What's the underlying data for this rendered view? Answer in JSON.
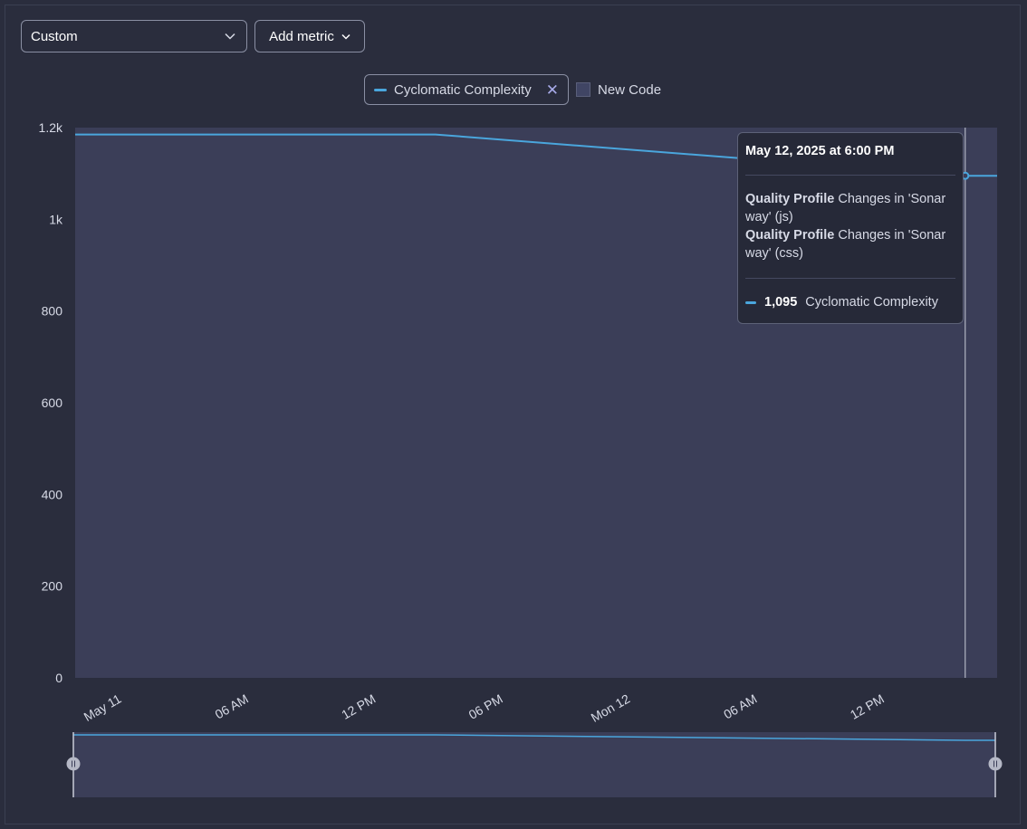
{
  "toolbar": {
    "graph_select": {
      "value": "Custom",
      "icon": "chevron-down-icon"
    },
    "add_metric_label": "Add metric"
  },
  "legend": {
    "series_label": "Cyclomatic Complexity",
    "series_color": "#4aa6dd",
    "remove_icon": "close-icon",
    "new_code_label": "New Code"
  },
  "tooltip": {
    "date": "May 12, 2025 at 6:00 PM",
    "events": [
      {
        "category": "Quality Profile",
        "text": "Changes in 'Sonar way' (js)"
      },
      {
        "category": "Quality Profile",
        "text": "Changes in 'Sonar way' (css)"
      }
    ],
    "value": "1,095",
    "series": "Cyclomatic Complexity"
  },
  "chart_data": {
    "type": "line",
    "ylim": [
      0,
      1200
    ],
    "yticks": [
      "0",
      "200",
      "400",
      "600",
      "800",
      "1k",
      "1.2k"
    ],
    "xticks": [
      "May 11",
      "06 AM",
      "12 PM",
      "06 PM",
      "Mon 12",
      "06 AM",
      "12 PM"
    ],
    "series": [
      {
        "name": "Cyclomatic Complexity",
        "color": "#4aa6dd",
        "points": [
          {
            "t": "2025-05-11 00:00",
            "y": 1185
          },
          {
            "t": "2025-05-11 17:00",
            "y": 1185
          },
          {
            "t": "2025-05-12 18:00",
            "y": 1095
          },
          {
            "t": "2025-05-12 19:00",
            "y": 1095
          }
        ]
      }
    ],
    "grid": false
  }
}
